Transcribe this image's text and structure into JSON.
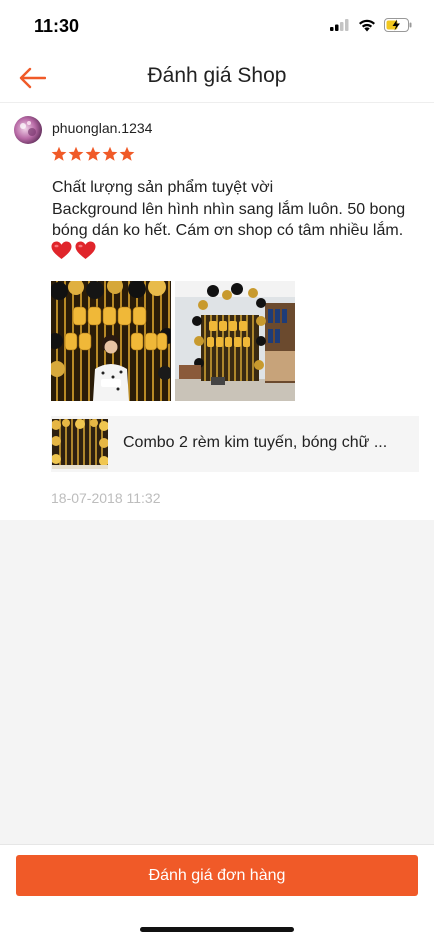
{
  "status_bar": {
    "time": "11:30"
  },
  "header": {
    "title": "Đánh giá Shop"
  },
  "review": {
    "username": "phuonglan.1234",
    "rating": 5,
    "text_lines": [
      "Chất lượng sản phẩm tuyệt vời",
      "Background lên hình nhìn sang lắm luôn. 50 bong",
      "bóng dán ko hết. Cám ơn shop có tâm nhiều lắm."
    ],
    "emoji": "❤️❤️",
    "product_name": "Combo 2 rèm kim tuyến, bóng chữ ...",
    "date": "18-07-2018 11:32"
  },
  "footer": {
    "button_label": "Đánh giá đơn hàng"
  },
  "colors": {
    "accent": "#f05a28",
    "star": "#f05a28",
    "date": "#bdbdbd"
  },
  "icons": [
    "back-arrow-icon",
    "signal-icon",
    "wifi-icon",
    "battery-charging-icon",
    "star-icon",
    "heart-icon"
  ]
}
